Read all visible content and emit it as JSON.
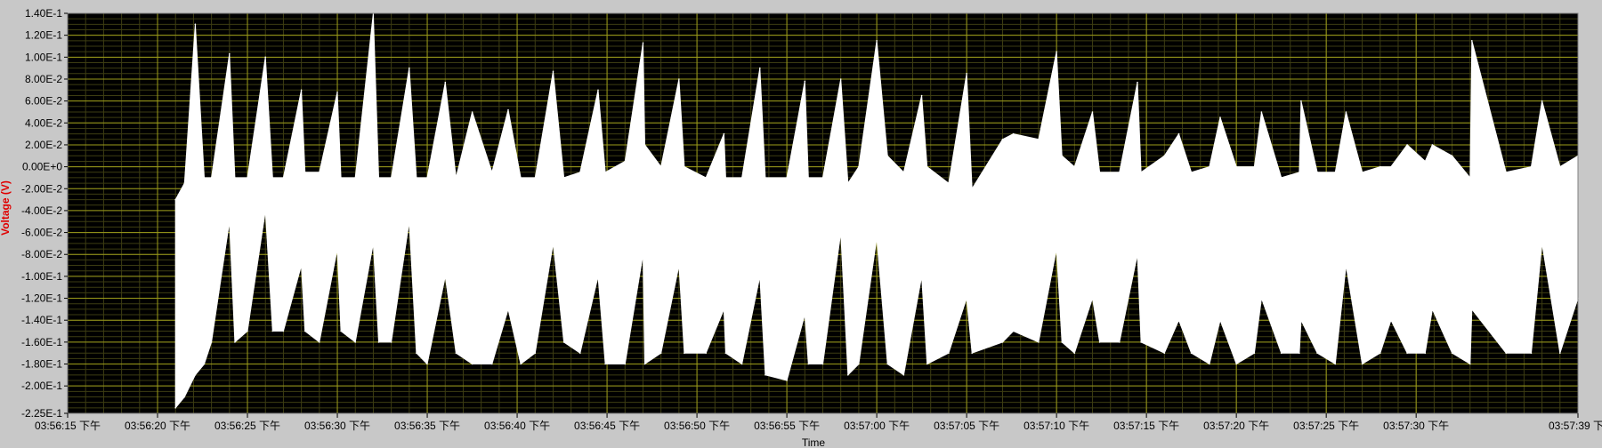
{
  "chart_data": {
    "type": "line",
    "title": "",
    "xlabel": "Time",
    "ylabel": "Voltage (V)",
    "grid": true,
    "ylim": [
      -0.225,
      0.14
    ],
    "xlim": [
      "03:56:15",
      "03:57:39"
    ],
    "colors": {
      "plot_bg": "#000000",
      "grid_major": "#9c9c1a",
      "grid_minor": "#3d3d12",
      "trace": "#ffffff",
      "frame": "#c8c8c8",
      "ylabel": "#e00000"
    },
    "y_ticks": [
      {
        "v": 0.14,
        "label": "1.40E-1"
      },
      {
        "v": 0.12,
        "label": "1.20E-1"
      },
      {
        "v": 0.1,
        "label": "1.00E-1"
      },
      {
        "v": 0.08,
        "label": "8.00E-2"
      },
      {
        "v": 0.06,
        "label": "6.00E-2"
      },
      {
        "v": 0.04,
        "label": "4.00E-2"
      },
      {
        "v": 0.02,
        "label": "2.00E-2"
      },
      {
        "v": 0.0,
        "label": "0.00E+0"
      },
      {
        "v": -0.02,
        "label": "-2.00E-2"
      },
      {
        "v": -0.04,
        "label": "-4.00E-2"
      },
      {
        "v": -0.06,
        "label": "-6.00E-2"
      },
      {
        "v": -0.08,
        "label": "-8.00E-2"
      },
      {
        "v": -0.1,
        "label": "-1.00E-1"
      },
      {
        "v": -0.12,
        "label": "-1.20E-1"
      },
      {
        "v": -0.14,
        "label": "-1.40E-1"
      },
      {
        "v": -0.16,
        "label": "-1.60E-1"
      },
      {
        "v": -0.18,
        "label": "-1.80E-1"
      },
      {
        "v": -0.2,
        "label": "-2.00E-1"
      },
      {
        "v": -0.225,
        "label": "-2.25E-1"
      }
    ],
    "x_ticks": [
      {
        "t": "03:56:15",
        "label": "03:56:15 下午"
      },
      {
        "t": "03:56:20",
        "label": "03:56:20 下午"
      },
      {
        "t": "03:56:25",
        "label": "03:56:25 下午"
      },
      {
        "t": "03:56:30",
        "label": "03:56:30 下午"
      },
      {
        "t": "03:56:35",
        "label": "03:56:35 下午"
      },
      {
        "t": "03:56:40",
        "label": "03:56:40 下午"
      },
      {
        "t": "03:56:45",
        "label": "03:56:45 下午"
      },
      {
        "t": "03:56:50",
        "label": "03:56:50 下午"
      },
      {
        "t": "03:56:55",
        "label": "03:56:55 下午"
      },
      {
        "t": "03:57:00",
        "label": "03:57:00 下午"
      },
      {
        "t": "03:57:05",
        "label": "03:57:05 下午"
      },
      {
        "t": "03:57:10",
        "label": "03:57:10 下午"
      },
      {
        "t": "03:57:15",
        "label": "03:57:15 下午"
      },
      {
        "t": "03:57:20",
        "label": "03:57:20 下午"
      },
      {
        "t": "03:57:25",
        "label": "03:57:25 下午"
      },
      {
        "t": "03:57:30",
        "label": "03:57:30 下午"
      },
      {
        "t": "03:57:39",
        "label": "03:57:39 下"
      }
    ],
    "series": [
      {
        "envelope": true,
        "x": [
          "03:56:21.0",
          "03:56:21.5",
          "03:56:22.1",
          "03:56:22.6",
          "03:56:23.0",
          "03:56:24.0",
          "03:56:24.3",
          "03:56:25.0",
          "03:56:26.0",
          "03:56:26.4",
          "03:56:27.0",
          "03:56:28.0",
          "03:56:28.2",
          "03:56:29.0",
          "03:56:30.0",
          "03:56:30.2",
          "03:56:31.0",
          "03:56:32.0",
          "03:56:32.3",
          "03:56:33.0",
          "03:56:34.0",
          "03:56:34.4",
          "03:56:35.0",
          "03:56:36.0",
          "03:56:36.6",
          "03:56:37.5",
          "03:56:38.6",
          "03:56:39.5",
          "03:56:40.2",
          "03:56:41.0",
          "03:56:42.0",
          "03:56:42.6",
          "03:56:43.5",
          "03:56:44.5",
          "03:56:44.9",
          "03:56:46.0",
          "03:56:47.0",
          "03:56:47.1",
          "03:56:48.0",
          "03:56:49.0",
          "03:56:49.3",
          "03:56:50.5",
          "03:56:51.5",
          "03:56:51.6",
          "03:56:52.5",
          "03:56:53.5",
          "03:56:53.8",
          "03:56:55.0",
          "03:56:56.0",
          "03:56:56.2",
          "03:56:57.0",
          "03:56:58.0",
          "03:56:58.4",
          "03:56:59.0",
          "03:57:00.0",
          "03:57:00.6",
          "03:57:01.5",
          "03:57:02.5",
          "03:57:02.8",
          "03:57:04.0",
          "03:57:05.0",
          "03:57:05.3",
          "03:57:07.0",
          "03:57:07.6",
          "03:57:09.0",
          "03:57:10.0",
          "03:57:10.3",
          "03:57:11.0",
          "03:57:12.0",
          "03:57:12.4",
          "03:57:13.5",
          "03:57:14.5",
          "03:57:14.7",
          "03:57:16.0",
          "03:57:16.8",
          "03:57:17.5",
          "03:57:18.5",
          "03:57:19.1",
          "03:57:20.0",
          "03:57:21.0",
          "03:57:21.4",
          "03:57:22.5",
          "03:57:23.5",
          "03:57:23.6",
          "03:57:24.5",
          "03:57:25.5",
          "03:57:26.1",
          "03:57:27.0",
          "03:57:28.0",
          "03:57:28.6",
          "03:57:29.5",
          "03:57:30.5",
          "03:57:30.9",
          "03:57:32.0",
          "03:57:33.0",
          "03:57:33.1",
          "03:57:35.0",
          "03:57:36.4",
          "03:57:37.0",
          "03:57:38.0",
          "03:57:39.0"
        ],
        "y_max": [
          -0.03,
          -0.015,
          0.13,
          -0.01,
          -0.01,
          0.103,
          -0.01,
          -0.01,
          0.1,
          -0.01,
          -0.01,
          0.07,
          -0.005,
          -0.005,
          0.068,
          -0.01,
          -0.01,
          0.14,
          -0.01,
          -0.01,
          0.09,
          -0.01,
          -0.01,
          0.077,
          -0.01,
          0.05,
          -0.005,
          0.052,
          -0.01,
          -0.01,
          0.087,
          -0.01,
          -0.005,
          0.07,
          -0.005,
          0.005,
          0.113,
          0.02,
          0.0,
          0.08,
          0.0,
          -0.01,
          0.03,
          -0.01,
          -0.01,
          0.09,
          -0.01,
          -0.01,
          0.078,
          -0.01,
          -0.01,
          0.08,
          -0.015,
          0.0,
          0.115,
          0.01,
          -0.005,
          0.065,
          0.0,
          -0.015,
          0.085,
          -0.02,
          0.025,
          0.03,
          0.025,
          0.105,
          0.01,
          0.0,
          0.05,
          -0.005,
          -0.005,
          0.077,
          -0.005,
          0.01,
          0.03,
          -0.005,
          0.0,
          0.045,
          0.0,
          0.0,
          0.05,
          -0.01,
          -0.005,
          0.06,
          -0.005,
          -0.005,
          0.05,
          -0.005,
          0.0,
          0.0,
          0.02,
          0.005,
          0.02,
          0.01,
          -0.01,
          0.115,
          -0.005,
          0.0,
          0.06,
          0.0,
          0.01
        ],
        "y_min": [
          -0.22,
          -0.21,
          -0.19,
          -0.18,
          -0.16,
          -0.05,
          -0.16,
          -0.15,
          -0.04,
          -0.15,
          -0.15,
          -0.09,
          -0.15,
          -0.16,
          -0.075,
          -0.15,
          -0.16,
          -0.07,
          -0.16,
          -0.16,
          -0.05,
          -0.17,
          -0.18,
          -0.1,
          -0.17,
          -0.18,
          -0.18,
          -0.13,
          -0.18,
          -0.17,
          -0.07,
          -0.16,
          -0.17,
          -0.1,
          -0.18,
          -0.18,
          -0.08,
          -0.18,
          -0.17,
          -0.09,
          -0.17,
          -0.17,
          -0.13,
          -0.17,
          -0.18,
          -0.1,
          -0.19,
          -0.195,
          -0.135,
          -0.18,
          -0.18,
          -0.06,
          -0.19,
          -0.18,
          -0.065,
          -0.18,
          -0.19,
          -0.1,
          -0.18,
          -0.17,
          -0.12,
          -0.17,
          -0.16,
          -0.15,
          -0.16,
          -0.075,
          -0.16,
          -0.17,
          -0.12,
          -0.16,
          -0.16,
          -0.08,
          -0.16,
          -0.17,
          -0.14,
          -0.17,
          -0.18,
          -0.14,
          -0.18,
          -0.17,
          -0.12,
          -0.17,
          -0.17,
          -0.14,
          -0.17,
          -0.18,
          -0.09,
          -0.18,
          -0.17,
          -0.14,
          -0.17,
          -0.17,
          -0.13,
          -0.17,
          -0.18,
          -0.13,
          -0.17,
          -0.17,
          -0.07,
          -0.17,
          -0.12
        ]
      }
    ]
  }
}
